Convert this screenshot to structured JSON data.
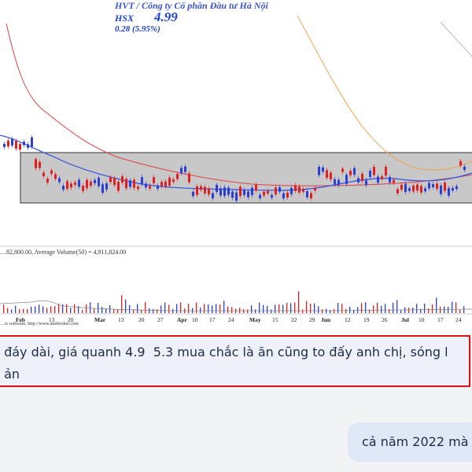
{
  "chart_header": {
    "company_name": "HVT / Công ty Cổ phần Đầu tư Hà Nội",
    "exchange": "HSX",
    "price": "4.99",
    "change": "0.28 (5.95%)"
  },
  "volume_label": "…82,800.00, Average Volume(50) = 4,911,824.00",
  "credit": "…is software, http://www.amibroker.com",
  "x_axis_labels": [
    "Feb",
    "13",
    "20",
    "Mar",
    "13",
    "20",
    "27",
    "Apr",
    "10",
    "17",
    "24",
    "May",
    "15",
    "22",
    "29",
    "Jun",
    "12",
    "19",
    "26",
    "Jul",
    "10",
    "17",
    "24"
  ],
  "caption": {
    "line1": " đáy dài, giá quanh 4.9  5.3 mua chắc là ăn cũng to đấy anh chị, sóng l",
    "line2": " ản"
  },
  "message": {
    "text": "cả năm 2022 mà"
  },
  "colors": {
    "up_candle": "#2b3fd4",
    "down_candle": "#e02020",
    "range_box": "#c8c8c8",
    "ma_red": "#e04040",
    "ma_orange": "#f0a050",
    "ma_blue": "#3050e0",
    "caption_border": "#e01010"
  }
}
